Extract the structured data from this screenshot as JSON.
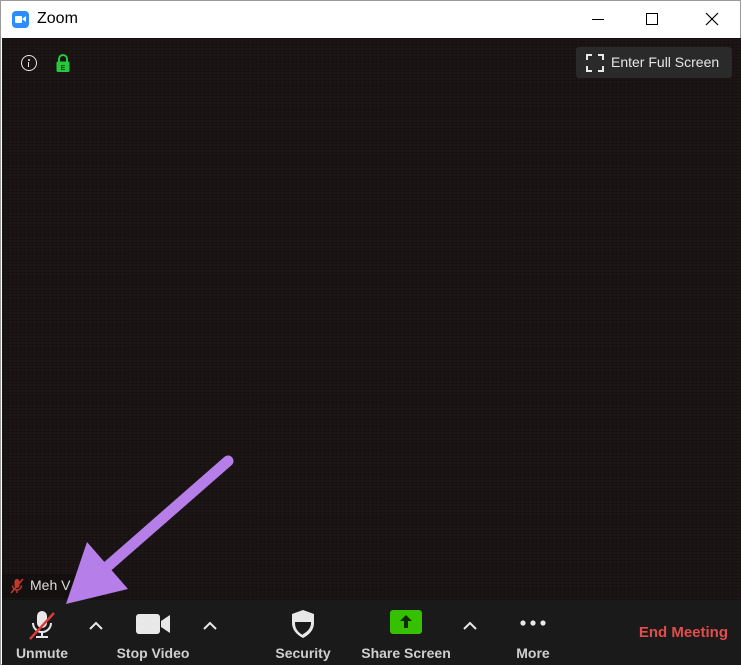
{
  "window": {
    "title": "Zoom",
    "controls": [
      "minimize",
      "maximize",
      "close"
    ]
  },
  "video": {
    "fullscreen_label": "Enter Full Screen",
    "participant_name": "Meh V",
    "participant_muted": true,
    "icons": [
      "info-icon",
      "encryption-lock-icon"
    ]
  },
  "toolbar": {
    "unmute_label": "Unmute",
    "stop_video_label": "Stop Video",
    "security_label": "Security",
    "share_screen_label": "Share Screen",
    "more_label": "More",
    "end_meeting_label": "End Meeting"
  },
  "colors": {
    "zoom_blue": "#2d8cff",
    "lock_green": "#25c93c",
    "share_green": "#35c000",
    "end_meeting_red": "#e24c4c",
    "toolbar_bg": "#1a1a1a",
    "annotation_arrow": "#b57ee8"
  }
}
